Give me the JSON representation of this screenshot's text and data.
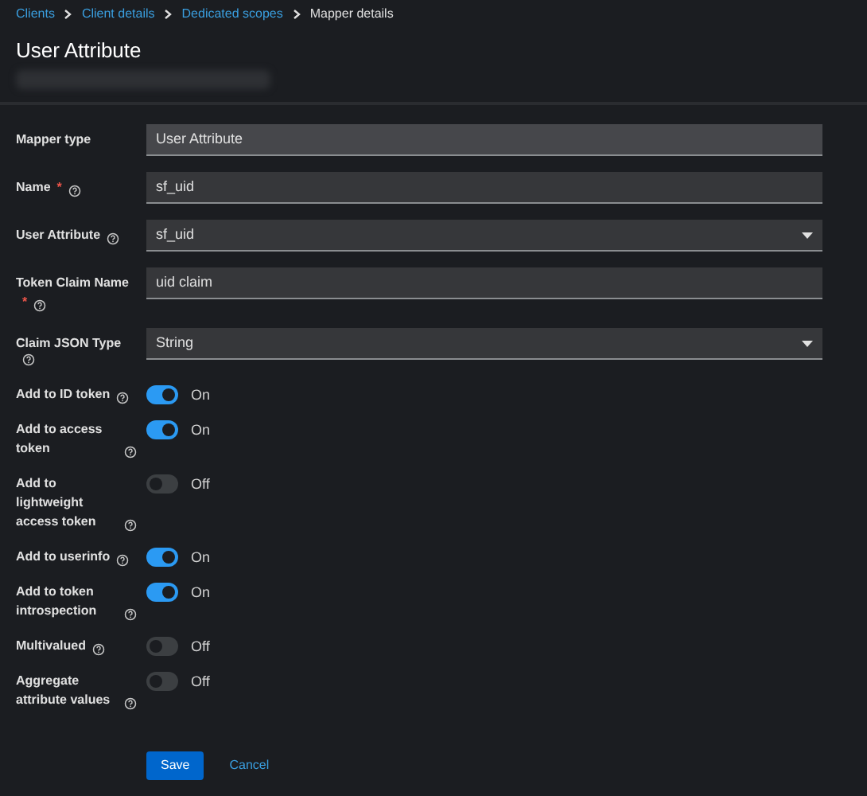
{
  "breadcrumbs": [
    {
      "label": "Clients",
      "link": true
    },
    {
      "label": "Client details",
      "link": true
    },
    {
      "label": "Dedicated scopes",
      "link": true
    },
    {
      "label": "Mapper details",
      "link": false
    }
  ],
  "title": "User Attribute",
  "fields": [
    {
      "label": "Mapper type",
      "help": false,
      "kind": "readonly",
      "value": "User Attribute"
    },
    {
      "label": "Name",
      "required_mark": "*",
      "help": true,
      "kind": "text",
      "value": "sf_uid"
    },
    {
      "label": "User Attribute",
      "help": true,
      "kind": "select",
      "value": "sf_uid"
    },
    {
      "label": "Token Claim Name",
      "required_mark": "*",
      "help": true,
      "kind": "text",
      "value": "uid claim"
    },
    {
      "label": "Claim JSON Type",
      "help": true,
      "kind": "select",
      "value": "String"
    }
  ],
  "toggles": [
    {
      "label": "Add to ID token",
      "on": true,
      "state_text": "On"
    },
    {
      "label": "Add to access token",
      "on": true,
      "state_text": "On"
    },
    {
      "label": "Add to lightweight access token",
      "on": false,
      "state_text": "Off"
    },
    {
      "label": "Add to userinfo",
      "on": true,
      "state_text": "On"
    },
    {
      "label": "Add to token introspection",
      "on": true,
      "state_text": "On"
    },
    {
      "label": "Multivalued",
      "on": false,
      "state_text": "Off"
    },
    {
      "label": "Aggregate attribute values",
      "on": false,
      "state_text": "Off"
    }
  ],
  "buttons": [
    {
      "label": "Save",
      "kind": "primary"
    },
    {
      "label": "Cancel",
      "kind": "link"
    }
  ]
}
